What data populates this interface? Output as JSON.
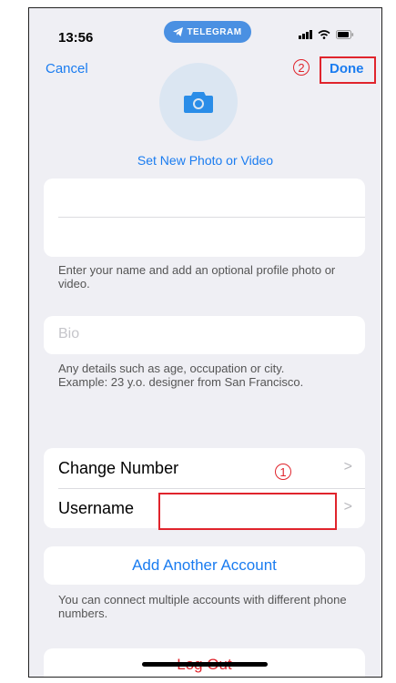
{
  "status_bar": {
    "time": "13:56",
    "telegram_pill": "TELEGRAM"
  },
  "nav": {
    "cancel_label": "Cancel",
    "done_label": "Done"
  },
  "annotations": {
    "marker_1": "1",
    "marker_2": "2",
    "color": "#e0242c"
  },
  "profile": {
    "set_photo_label": "Set New Photo or Video"
  },
  "name_section": {
    "first_name_value": "",
    "last_name_value": "",
    "note": "Enter your name and add an optional profile photo or video."
  },
  "bio_section": {
    "placeholder": "Bio",
    "note_lines": [
      "Any details such as age, occupation or city.",
      "Example: 23 y.o. designer from San Francisco."
    ]
  },
  "menu": {
    "items": [
      {
        "label": "Change Number",
        "value": ""
      },
      {
        "label": "Username",
        "value": ""
      }
    ]
  },
  "accounts": {
    "add_label": "Add Another Account",
    "note": "You can connect multiple accounts with different phone numbers."
  },
  "logout_label": "Log Out",
  "colors": {
    "accent": "#1a7cf0",
    "background": "#efeff4",
    "destructive": "#e0242c"
  }
}
